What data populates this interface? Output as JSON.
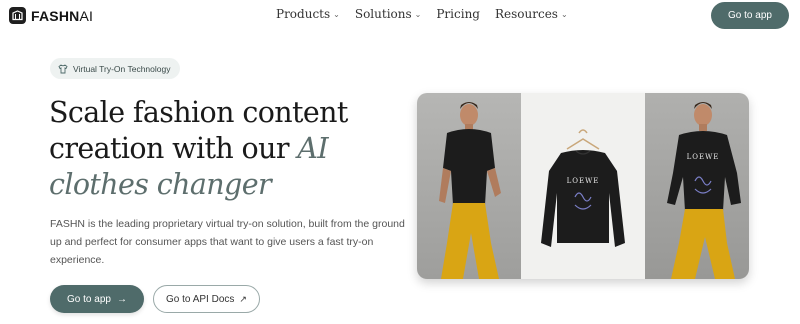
{
  "brand": {
    "name_bold": "FASHN",
    "name_light": "AI"
  },
  "nav": {
    "items": [
      {
        "label": "Products",
        "dropdown": true
      },
      {
        "label": "Solutions",
        "dropdown": true
      },
      {
        "label": "Pricing",
        "dropdown": false
      },
      {
        "label": "Resources",
        "dropdown": true
      }
    ],
    "chevron": "⌄"
  },
  "header": {
    "cta_label": "Go to app"
  },
  "hero": {
    "badge": "Virtual Try-On Technology",
    "headline_plain": "Scale fashion content creation with our ",
    "headline_emphasis": "AI clothes changer",
    "description": "FASHN is the leading proprietary virtual try-on solution, built from the ground up and perfect for consumer apps that want to give users a fast try-on experience.",
    "primary_button": "Go to app",
    "primary_icon": "→",
    "secondary_button": "Go to API Docs",
    "secondary_icon": "↗",
    "garment_label": "LOEWE"
  },
  "colors": {
    "accent": "#4f6b6a",
    "badge_bg": "#eef2f1",
    "pants": "#d9a514",
    "sweater": "#1c1c1c"
  }
}
